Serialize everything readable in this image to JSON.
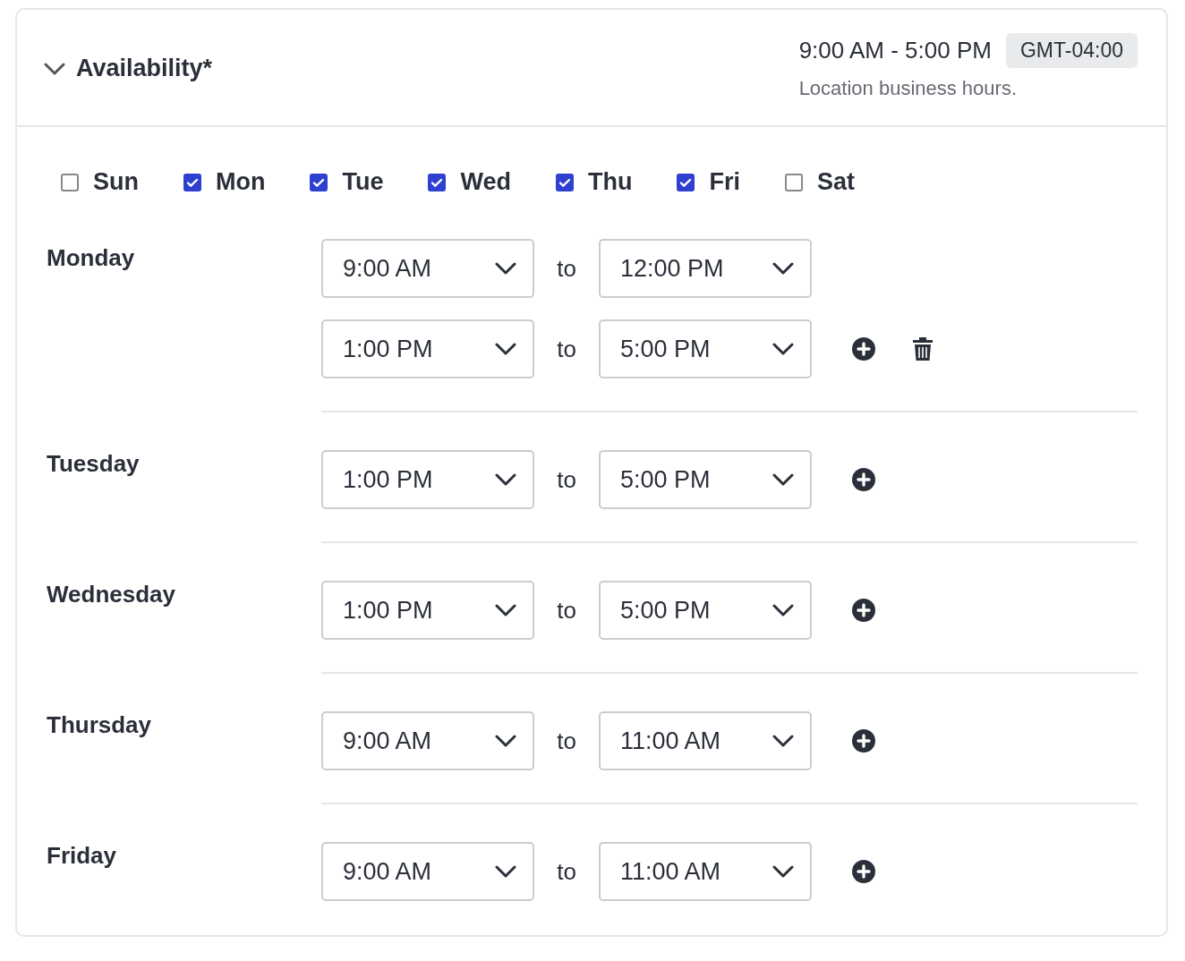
{
  "section": {
    "title": "Availability*",
    "expanded": true,
    "hours": "9:00 AM - 5:00 PM",
    "timezone": "GMT-04:00",
    "note": "Location business hours."
  },
  "days": [
    {
      "label": "Sun",
      "checked": false
    },
    {
      "label": "Mon",
      "checked": true
    },
    {
      "label": "Tue",
      "checked": true
    },
    {
      "label": "Wed",
      "checked": true
    },
    {
      "label": "Thu",
      "checked": true
    },
    {
      "label": "Fri",
      "checked": true
    },
    {
      "label": "Sat",
      "checked": false
    }
  ],
  "schedule": [
    {
      "day": "Monday",
      "deletable": true,
      "slots": [
        {
          "from": "9:00 AM",
          "separator": "to",
          "to": "12:00 PM"
        },
        {
          "from": "1:00 PM",
          "separator": "to",
          "to": "5:00 PM"
        }
      ]
    },
    {
      "day": "Tuesday",
      "deletable": false,
      "slots": [
        {
          "from": "1:00 PM",
          "separator": "to",
          "to": "5:00 PM"
        }
      ]
    },
    {
      "day": "Wednesday",
      "deletable": false,
      "slots": [
        {
          "from": "1:00 PM",
          "separator": "to",
          "to": "5:00 PM"
        }
      ]
    },
    {
      "day": "Thursday",
      "deletable": false,
      "slots": [
        {
          "from": "9:00 AM",
          "separator": "to",
          "to": "11:00 AM"
        }
      ]
    },
    {
      "day": "Friday",
      "deletable": false,
      "slots": [
        {
          "from": "9:00 AM",
          "separator": "to",
          "to": "11:00 AM"
        }
      ]
    }
  ]
}
